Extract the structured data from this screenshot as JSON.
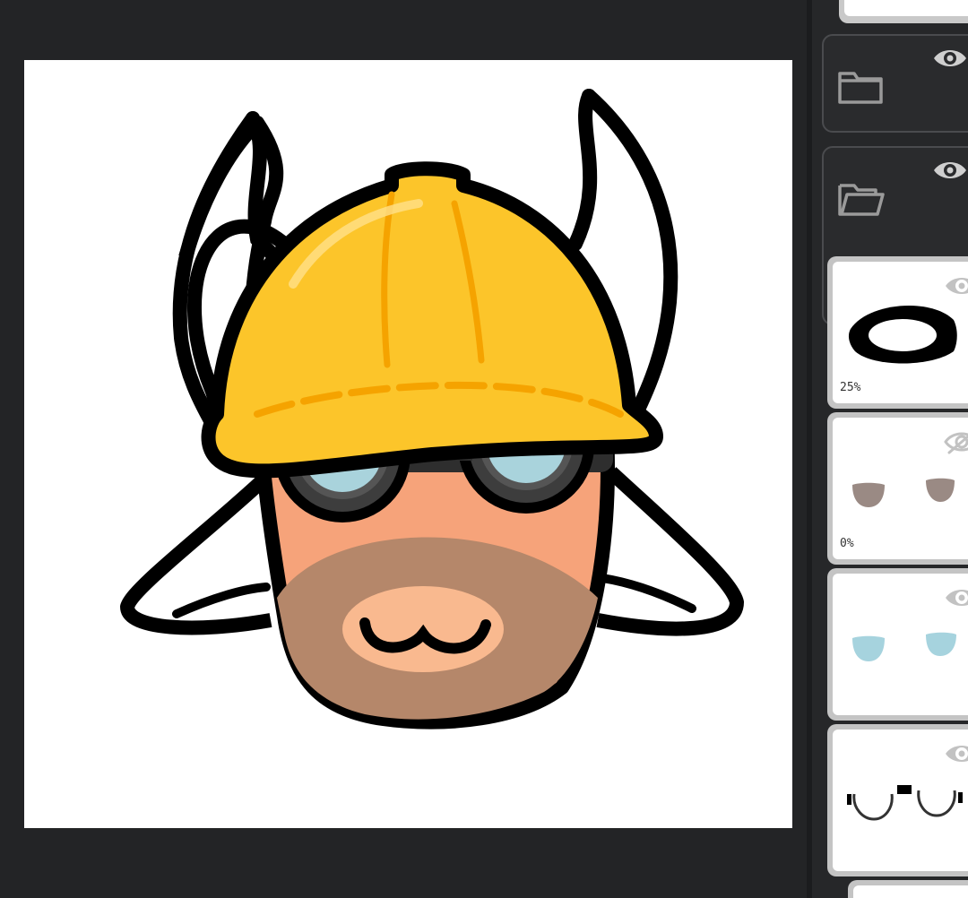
{
  "layers": [
    {
      "name": "folder-layer-collapsed",
      "kind": "folder",
      "state": "closed",
      "visible": true
    },
    {
      "name": "folder-layer-open",
      "kind": "folder",
      "state": "open",
      "visible": true
    },
    {
      "name": "goggle-frame-layer",
      "kind": "layer",
      "opacity_label": "25%",
      "visible": true
    },
    {
      "name": "cheeks-layer",
      "kind": "layer",
      "opacity_label": "0%",
      "visible": false
    },
    {
      "name": "goggle-lens-layer",
      "kind": "layer",
      "opacity_label": "",
      "visible": true
    },
    {
      "name": "goggle-outline-layer",
      "kind": "layer",
      "opacity_label": "",
      "visible": true
    }
  ],
  "colors": {
    "helmet": "#fcc52a",
    "helmet_stripe": "#f5a300",
    "face": "#f6a37a",
    "muzzle": "#b5876a",
    "nose": "#f9b98f",
    "lens": "#a9d3dc",
    "goggle_frame": "#3d3d3d",
    "outline": "#000000",
    "cheek": "#9a8a84",
    "lens_thumb": "#a6d3de"
  }
}
